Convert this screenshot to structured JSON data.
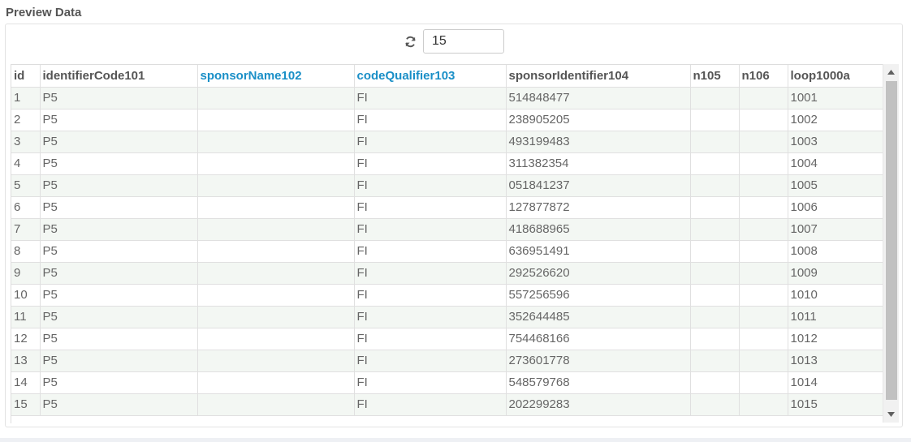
{
  "section_title": "Preview Data",
  "toolbar": {
    "row_count": "15"
  },
  "table": {
    "columns": [
      {
        "label": "id",
        "linked": false
      },
      {
        "label": "identifierCode101",
        "linked": false
      },
      {
        "label": "sponsorName102",
        "linked": true
      },
      {
        "label": "codeQualifier103",
        "linked": true
      },
      {
        "label": "sponsorIdentifier104",
        "linked": false
      },
      {
        "label": "n105",
        "linked": false
      },
      {
        "label": "n106",
        "linked": false
      },
      {
        "label": "loop1000a",
        "linked": false
      }
    ],
    "rows": [
      [
        "1",
        "P5",
        "",
        "FI",
        "514848477",
        "",
        "",
        "1001"
      ],
      [
        "2",
        "P5",
        "",
        "FI",
        "238905205",
        "",
        "",
        "1002"
      ],
      [
        "3",
        "P5",
        "",
        "FI",
        "493199483",
        "",
        "",
        "1003"
      ],
      [
        "4",
        "P5",
        "",
        "FI",
        "311382354",
        "",
        "",
        "1004"
      ],
      [
        "5",
        "P5",
        "",
        "FI",
        "051841237",
        "",
        "",
        "1005"
      ],
      [
        "6",
        "P5",
        "",
        "FI",
        "127877872",
        "",
        "",
        "1006"
      ],
      [
        "7",
        "P5",
        "",
        "FI",
        "418688965",
        "",
        "",
        "1007"
      ],
      [
        "8",
        "P5",
        "",
        "FI",
        "636951491",
        "",
        "",
        "1008"
      ],
      [
        "9",
        "P5",
        "",
        "FI",
        "292526620",
        "",
        "",
        "1009"
      ],
      [
        "10",
        "P5",
        "",
        "FI",
        "557256596",
        "",
        "",
        "1010"
      ],
      [
        "11",
        "P5",
        "",
        "FI",
        "352644485",
        "",
        "",
        "1011"
      ],
      [
        "12",
        "P5",
        "",
        "FI",
        "754468166",
        "",
        "",
        "1012"
      ],
      [
        "13",
        "P5",
        "",
        "FI",
        "273601778",
        "",
        "",
        "1013"
      ],
      [
        "14",
        "P5",
        "",
        "FI",
        "548579768",
        "",
        "",
        "1014"
      ],
      [
        "15",
        "P5",
        "",
        "FI",
        "202299283",
        "",
        "",
        "1015"
      ]
    ]
  },
  "colors": {
    "linked_header": "#1a8fc7",
    "row_stripe": "#f3f7f3"
  },
  "icons": {
    "refresh": "refresh-icon",
    "scroll_up": "scroll-up-arrow-icon",
    "scroll_down": "scroll-down-arrow-icon"
  }
}
